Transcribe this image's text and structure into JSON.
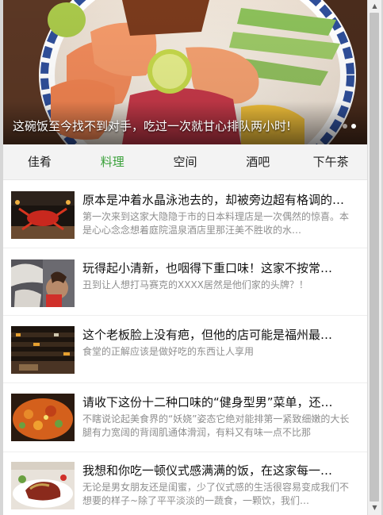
{
  "banner": {
    "caption": "这碗饭至今找不到对手，吃过一次就甘心排队两小时!",
    "dots": 2,
    "active_dot": 1
  },
  "tabs": [
    {
      "label": "佳肴",
      "active": false
    },
    {
      "label": "料理",
      "active": true
    },
    {
      "label": "空间",
      "active": false
    },
    {
      "label": "酒吧",
      "active": false
    },
    {
      "label": "下午茶",
      "active": false
    }
  ],
  "articles": [
    {
      "title": "原本是冲着水晶泳池去的，却被旁边超有格调的…",
      "desc": "第一次来到这家大隐隐于市的日本料理店是一次偶然的惊喜。本是心心念念想着庭院温泉酒店里那汪美不胜收的水…"
    },
    {
      "title": "玩得起小清新，也咽得下重口味！这家不按常…",
      "desc": "丑到让人想打马赛克的XXXX居然是他们家的头牌？！"
    },
    {
      "title": "这个老板脸上没有疤，但他的店可能是福州最…",
      "desc": "食堂的正解应该是做好吃的东西让人享用"
    },
    {
      "title": "请收下这份十二种口味的“健身型男”菜单，还…",
      "desc": "不瞎说论起美食界的“妖娆”姿态它绝对能排第一紧致细嫩的大长腿有力宽阔的背阔肌通体滑润，有料又有味一点不比那"
    },
    {
      "title": "我想和你吃一顿仪式感满满的饭，在这家每一…",
      "desc": "无论是男女朋友还是闺蜜，少了仪式感的生活很容易变成我们不想要的样子~除了平平淡淡的一蔬食，一颗饮，我们…"
    }
  ],
  "colors": {
    "active_tab": "#3aa13a",
    "tab_bar_bg": "#f3f3f3",
    "desc_text": "#8e8e8e"
  }
}
